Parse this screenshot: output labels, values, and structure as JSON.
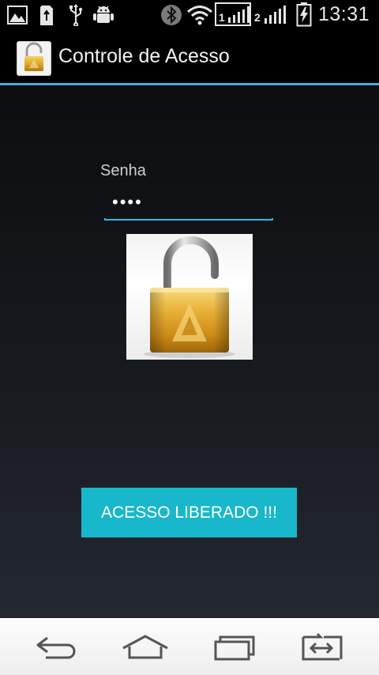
{
  "status_bar": {
    "time": "13:31",
    "sim1": "1",
    "sim2": "2",
    "icons": [
      "image-icon",
      "sd-card-icon",
      "usb-icon",
      "android-debug-icon",
      "bluetooth-icon",
      "wifi-icon",
      "signal-sim1-icon",
      "signal-sim2-icon",
      "battery-charging-icon"
    ]
  },
  "action_bar": {
    "title": "Controle de Acesso",
    "app_icon": "padlock-icon"
  },
  "form": {
    "password_label": "Senha",
    "password_value": "••••"
  },
  "lock_image": "open-padlock-icon",
  "button": {
    "label": "ACESSO LIBERADO !!!",
    "color": "#19b7cb"
  },
  "accent_color": "#33b5e5",
  "nav_bar": {
    "icons": [
      "back-icon",
      "home-icon",
      "recent-apps-icon",
      "dual-window-icon"
    ]
  }
}
